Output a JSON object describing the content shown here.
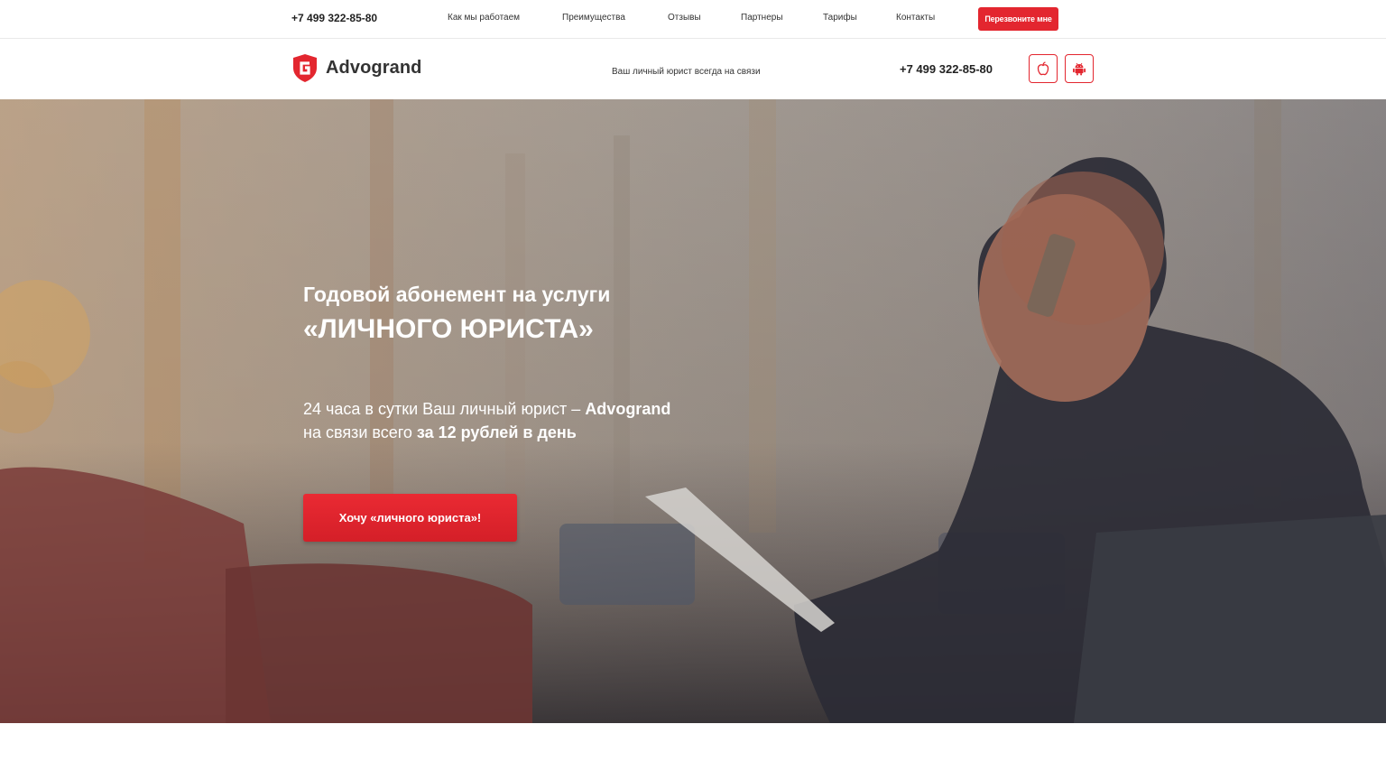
{
  "topbar": {
    "phone": "+7 499 322-85-80",
    "nav": [
      "Как мы работаем",
      "Преимущества",
      "Отзывы",
      "Партнеры",
      "Тарифы",
      "Контакты"
    ],
    "callback_label": "Перезвоните мне"
  },
  "header": {
    "logo_text": "Advogrand",
    "tagline": "Ваш личный юрист всегда на связи",
    "phone": "+7 499 322-85-80",
    "apps": [
      {
        "icon": "apple-icon"
      },
      {
        "icon": "android-icon"
      }
    ]
  },
  "hero": {
    "title_line1": "Годовой абонемент на услуги",
    "title_line2": "«ЛИЧНОГО ЮРИСТА»",
    "sub_part1": "24 часа в сутки Ваш личный юрист – ",
    "sub_brand": "Advogrand",
    "sub_part2": "на связи всего ",
    "sub_price": "за 12 рублей в день",
    "cta_label": "Хочу «личного юриста»!"
  },
  "colors": {
    "accent": "#e3262f",
    "text": "#222222"
  }
}
